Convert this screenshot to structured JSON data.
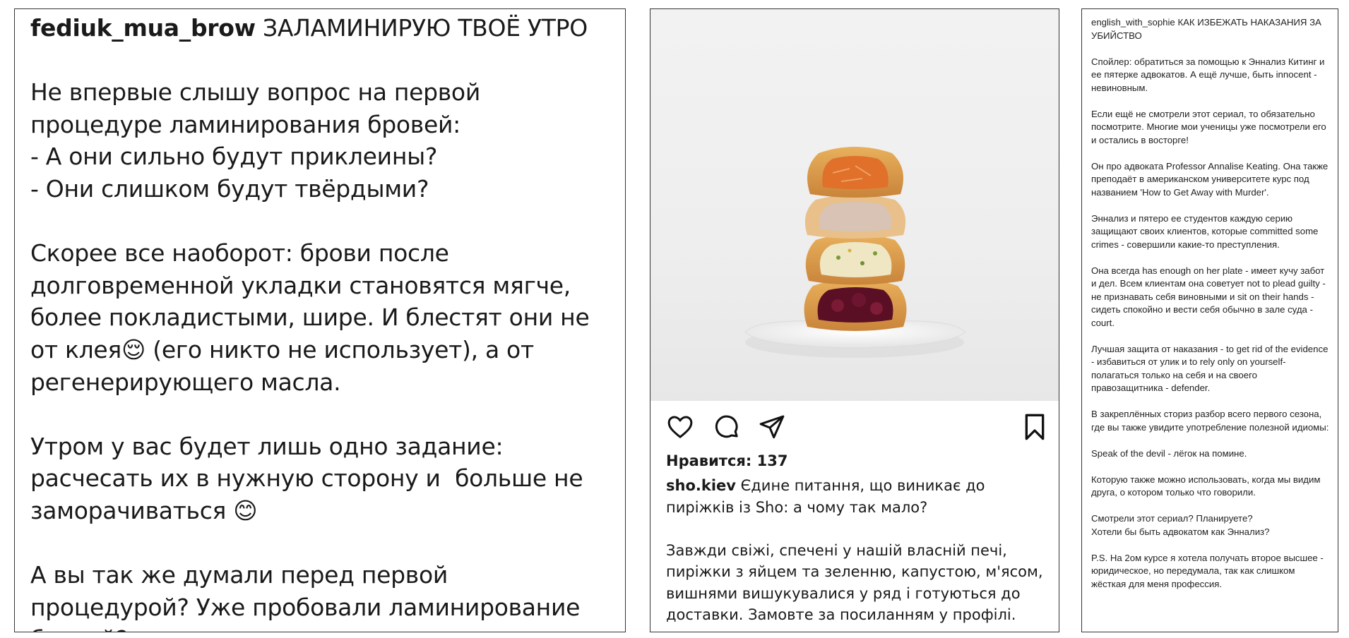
{
  "post_left": {
    "username": "fediuk_mua_brow",
    "caption": " ЗАЛАМИНИРУЮ ТВОЁ УТРО\n\nНе впервые слышу вопрос на первой процедуре ламинирования бровей:\n- А они сильно будут приклеины?\n- Они слишком будут твёрдыми?\n\nСкорее все наоборот: брови после долговременной укладки становятся мягче, более покладистыми, шире. И блестят они не от клея😌 (его никто не использует), а от регенерирующего масла.\n\nУтром у вас будет лишь одно задание: расчесать их в нужную сторону и  больше не заморачиваться 😊\n\nА вы так же думали перед первой процедурой? Уже пробовали ламинирование бровей?"
  },
  "post_middle": {
    "photo_icon": "stacked-pies-photo",
    "actions": {
      "like_icon": "heart-icon",
      "comment_icon": "comment-icon",
      "share_icon": "send-icon",
      "save_icon": "bookmark-icon"
    },
    "likes_text": "Нравится: 137",
    "username": "sho.kiev",
    "caption": " Єдине питання, що виникає до пиріжків із Sho: а чому так мало?\n\nЗавжди свіжі, спечені у нашій власній печі, пиріжки з яйцем та зеленню, капустою, м'ясом, вишнями вишукувалися у ряд і готуються до доставки. Замовте за посиланням у профілі."
  },
  "post_right": {
    "username": "english_with_sophie",
    "caption": " КАК ИЗБЕЖАТЬ НАКАЗАНИЯ ЗА УБИЙСТВО\n\nСпойлер: обратиться за помощью к Эннализ Китинг и ее пятерке адвокатов. А ещё лучше, быть innocent - невиновным.\n\nЕсли ещё не смотрели этот сериал, то обязательно посмотрите. Многие мои ученицы уже посмотрели его и остались в восторге!\n\nОн про адвоката Professor Annalise Keating. Она также преподаёт в американском университете курс под названием 'How to Get Away with Murder'.\n\nЭннализ и пятеро ее студентов каждую серию защищают своих клиентов, которые committed some crimes - совершили какие-то преступления.\n\nОна всегда has enough on her plate - имеет кучу забот и дел. Всем клиентам она советует not to plead guilty - не признавать себя виновными и sit on their hands - сидеть спокойно и вести себя обычно в зале суда - court.\n\nЛучшая защита от наказания - to get rid of the evidence - избавиться от улик и to rely only on yourself- полагаться только на себя и на своего правозащитника - defender.\n\nВ закреплённых сториз разбор всего первого сезона, где вы также увидите употребление полезной идиомы:\n\nSpeak of the devil - лёгок на помине.\n\nКоторую также можно использовать, когда мы видим друга, о котором только что говорили.\n\nСмотрели этот сериал? Планируете?\nХотели бы быть адвокатом как Эннализ?\n\nP.S. На 2ом курсе я хотела получать второе высшее - юридическое, но передумала, так как слишком жёсткая для меня профессия."
  }
}
